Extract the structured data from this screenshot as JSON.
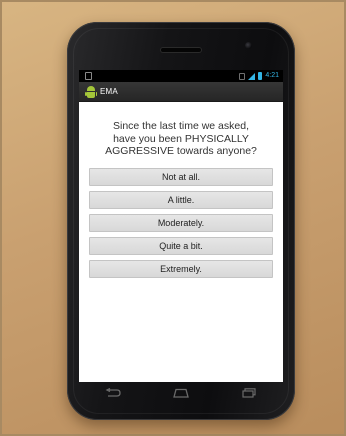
{
  "status_bar": {
    "time": "4:21",
    "accent_color": "#33b5e5"
  },
  "app": {
    "title": "EMA",
    "icon": "android-icon",
    "icon_color": "#a4c639"
  },
  "survey": {
    "question": "Since the last time we asked,\nhave you been PHYSICALLY\nAGGRESSIVE towards anyone?",
    "options": [
      {
        "label": "Not at all."
      },
      {
        "label": "A little."
      },
      {
        "label": "Moderately."
      },
      {
        "label": "Quite a bit."
      },
      {
        "label": "Extremely."
      }
    ]
  },
  "nav": {
    "back_icon": "back-icon",
    "home_icon": "home-icon",
    "recents_icon": "recent-apps-icon"
  }
}
